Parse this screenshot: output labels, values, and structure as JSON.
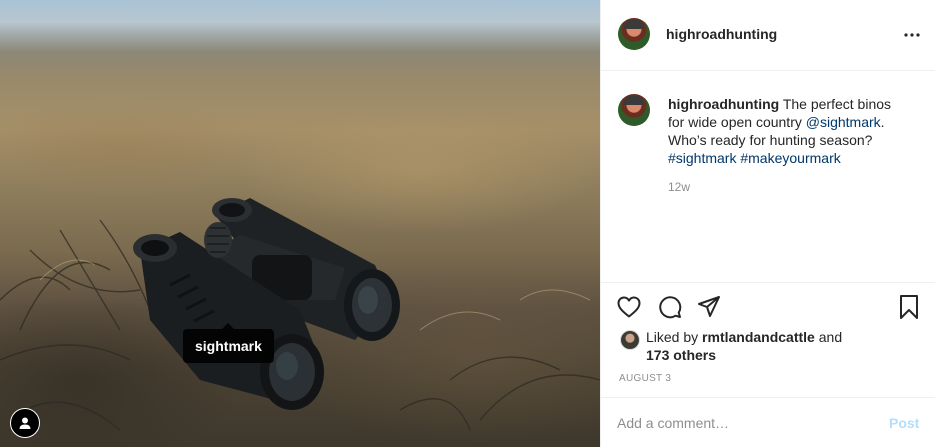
{
  "post": {
    "image": {
      "tag_label": "sightmark",
      "user_tag_icon": "user-icon"
    },
    "header": {
      "username": "highroadhunting",
      "more_icon": "more-horizontal-icon"
    },
    "caption": {
      "username": "highroadhunting",
      "text_part1": " The perfect binos for wide open country ",
      "mention": "@sightmark",
      "text_part2": ". Who’s ready for hunting season? ",
      "hashtag1": "#sightmark",
      "hashtag2": "#makeyourmark",
      "age": "12w"
    },
    "actions": {
      "like_icon": "heart-icon",
      "comment_icon": "comment-icon",
      "share_icon": "paper-plane-icon",
      "save_icon": "bookmark-icon"
    },
    "likes": {
      "prefix": "Liked by ",
      "user": "rmtlandandcattle",
      "conjunction": " and",
      "others": "173 others"
    },
    "date": "AUGUST 3",
    "comment": {
      "placeholder": "Add a comment…",
      "post_label": "Post"
    }
  },
  "colors": {
    "link": "#00376b",
    "secondary_text": "#8e8e8e",
    "post_button_disabled": "#b2dffc",
    "border": "#efefef"
  }
}
